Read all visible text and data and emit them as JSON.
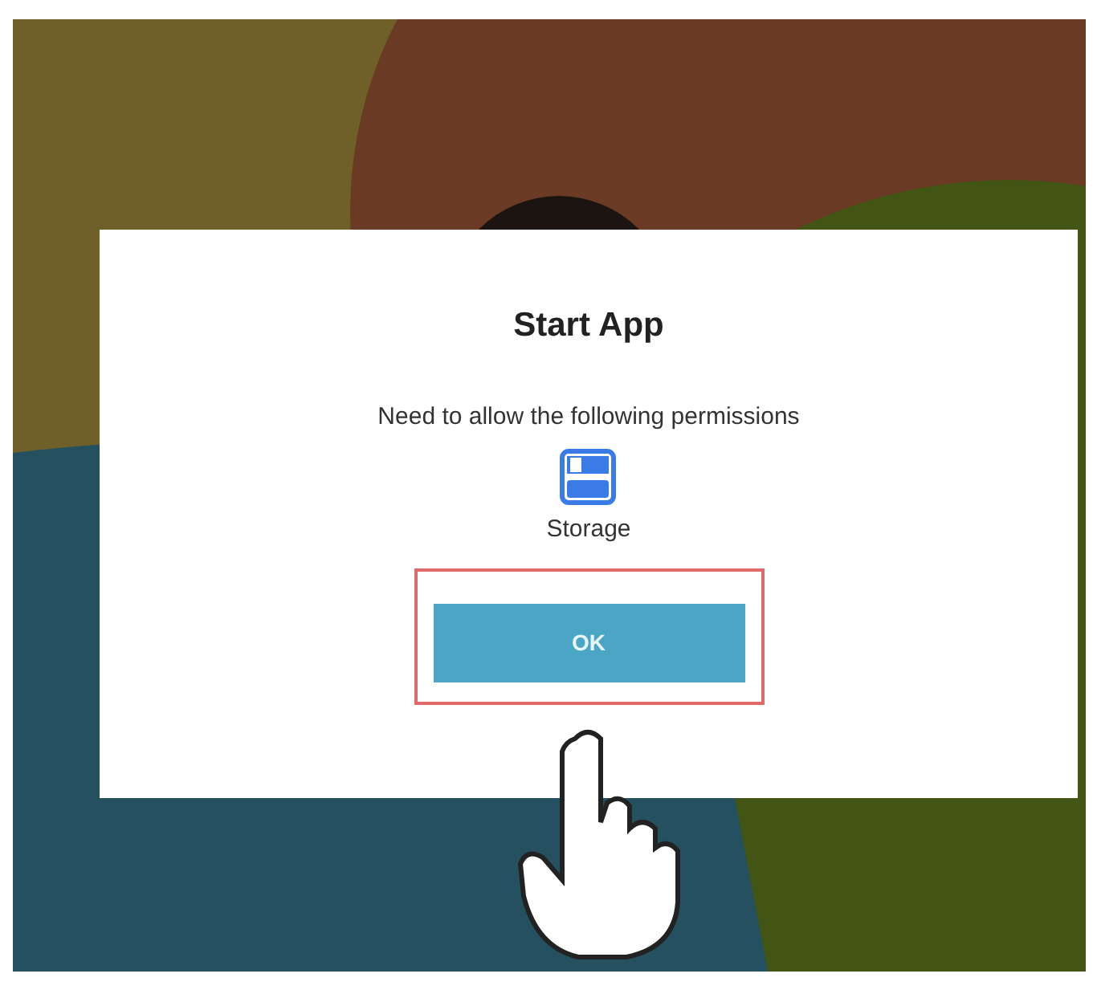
{
  "dialog": {
    "title": "Start App",
    "message": "Need to allow the following permissions",
    "permissions": [
      {
        "label": "Storage"
      }
    ],
    "button": {
      "label": "OK"
    }
  }
}
